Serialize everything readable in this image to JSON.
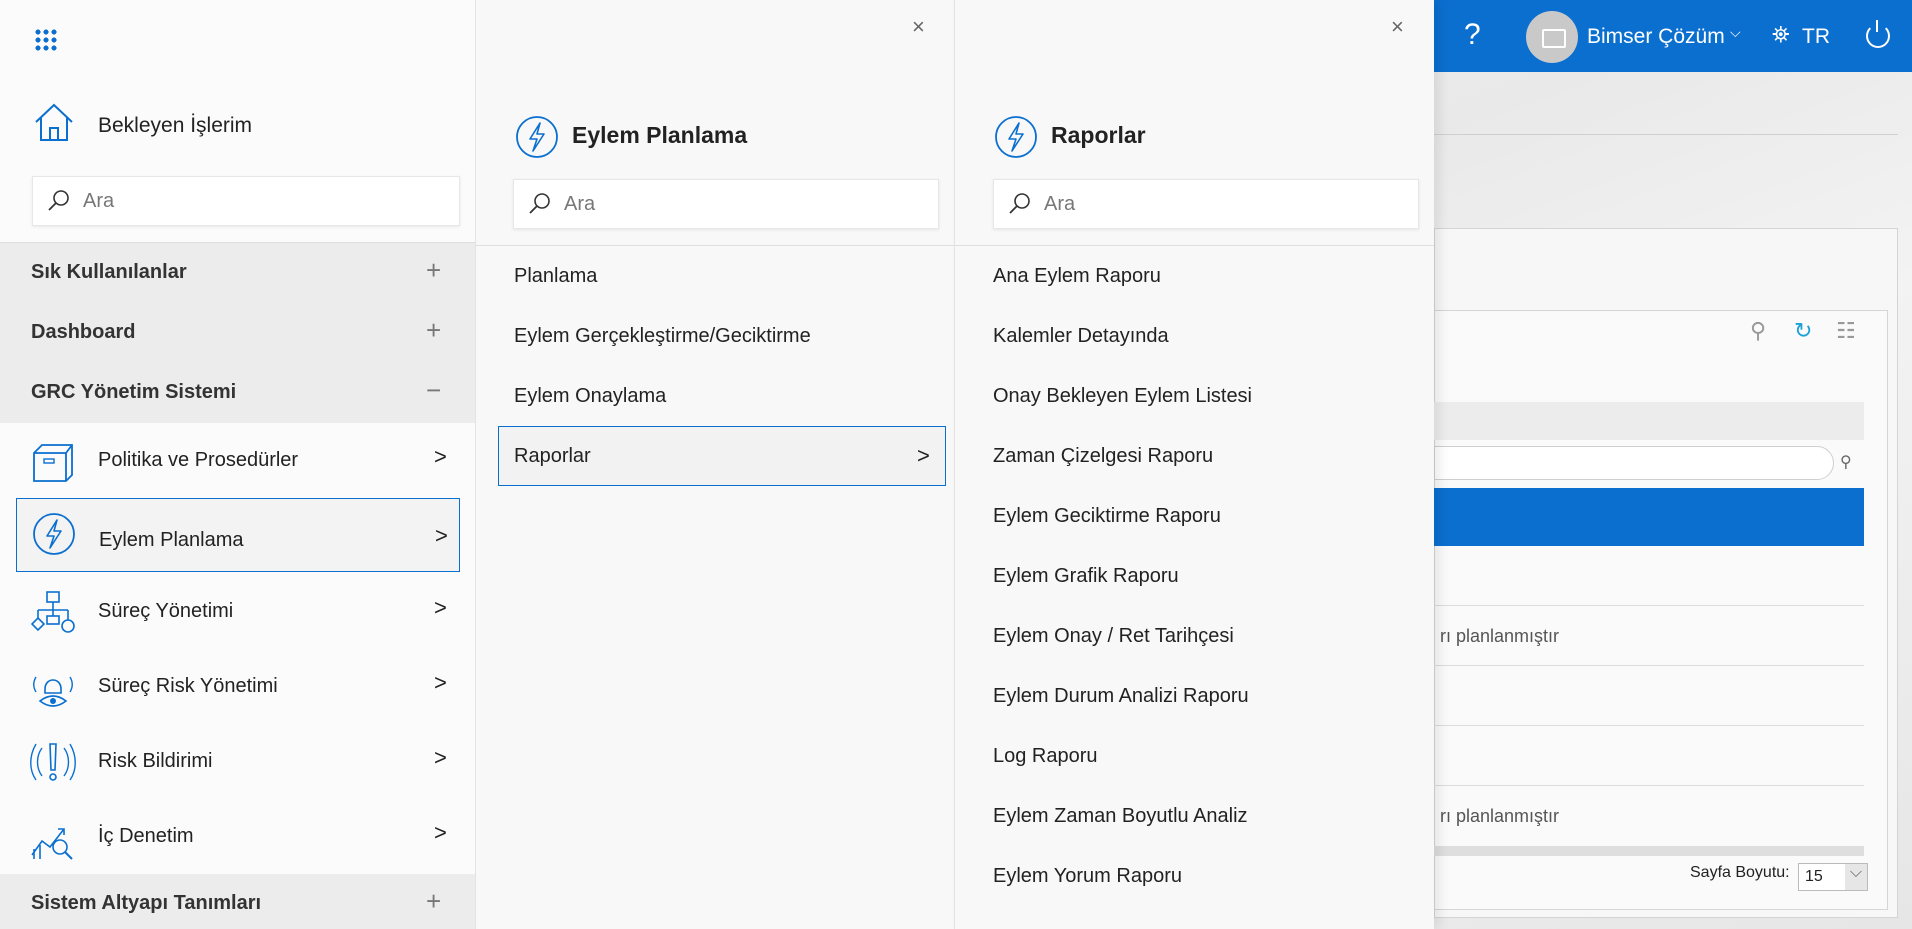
{
  "header": {
    "help": "?",
    "user_name": "Bimser Çözüm",
    "language": "TR"
  },
  "background": {
    "row_text_1": "rı planlanmıştır",
    "row_text_2": "rı planlanmıştır",
    "page_size_label": "Sayfa Boyutu:",
    "page_size_value": "15"
  },
  "main_menu": {
    "home_label": "Bekleyen İşlerim",
    "search_placeholder": "Ara",
    "sections": {
      "favorites": "Sık Kullanılanlar",
      "dashboard": "Dashboard",
      "grc": "GRC Yönetim Sistemi",
      "infra": "Sistem Altyapı Tanımları"
    },
    "items": [
      {
        "label": "Politika ve Prosedürler",
        "icon": "box-icon"
      },
      {
        "label": "Eylem Planlama",
        "icon": "lightning-icon"
      },
      {
        "label": "Süreç Yönetimi",
        "icon": "flowchart-icon"
      },
      {
        "label": "Süreç Risk Yönetimi",
        "icon": "bell-eye-icon"
      },
      {
        "label": "Risk Bildirimi",
        "icon": "alert-icon"
      },
      {
        "label": "İç Denetim",
        "icon": "chart-search-icon"
      }
    ]
  },
  "eylem_panel": {
    "title": "Eylem Planlama",
    "search_placeholder": "Ara",
    "items": [
      "Planlama",
      "Eylem Gerçekleştirme/Geciktirme",
      "Eylem Onaylama",
      "Raporlar"
    ]
  },
  "raporlar_panel": {
    "title": "Raporlar",
    "search_placeholder": "Ara",
    "items": [
      "Ana Eylem Raporu",
      "Kalemler Detayında",
      "Onay Bekleyen Eylem Listesi",
      "Zaman Çizelgesi Raporu",
      "Eylem Geciktirme Raporu",
      "Eylem Grafik Raporu",
      "Eylem Onay / Ret Tarihçesi",
      "Eylem Durum Analizi Raporu",
      "Log Raporu",
      "Eylem Zaman Boyutlu Analiz",
      "Eylem Yorum Raporu"
    ]
  },
  "colors": {
    "accent": "#0b6fd0"
  }
}
